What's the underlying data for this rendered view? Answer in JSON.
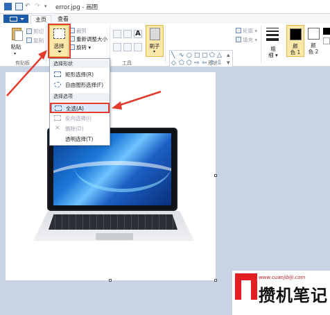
{
  "titlebar": {
    "title": "error.jpg - 画图"
  },
  "tabs": {
    "home": "主页",
    "view": "查看"
  },
  "clipboard": {
    "paste": "粘贴",
    "cut": "剪切",
    "copy": "复制",
    "group": "剪贴板"
  },
  "image": {
    "select": "选择",
    "crop": "裁剪",
    "resize": "重新调整大小",
    "rotate": "旋转"
  },
  "tools": {
    "group": "工具",
    "brush": "刷子"
  },
  "shapes": {
    "outline": "轮廓",
    "fill": "填充",
    "group": "形状"
  },
  "size": {
    "label_line1": "粗",
    "label_line2": "细"
  },
  "colors": {
    "color1_line1": "颜",
    "color1_line2": "色 1",
    "color2_line1": "颜",
    "color2_line2": "色 2",
    "color1": "#000000",
    "color2": "#ffffff"
  },
  "menu": {
    "header_shape": "选择形状",
    "rect_select": "矩形选择(R)",
    "free_select": "自由图形选择(F)",
    "header_options": "选择选项",
    "select_all": "全选(A)",
    "invert": "反向选择(I)",
    "delete": "删除(D)",
    "transparent": "透明选择(T)"
  },
  "watermark": {
    "url": "www.cuanjibiji.com",
    "text": "攒机笔记"
  },
  "accent": "#e53b2c"
}
